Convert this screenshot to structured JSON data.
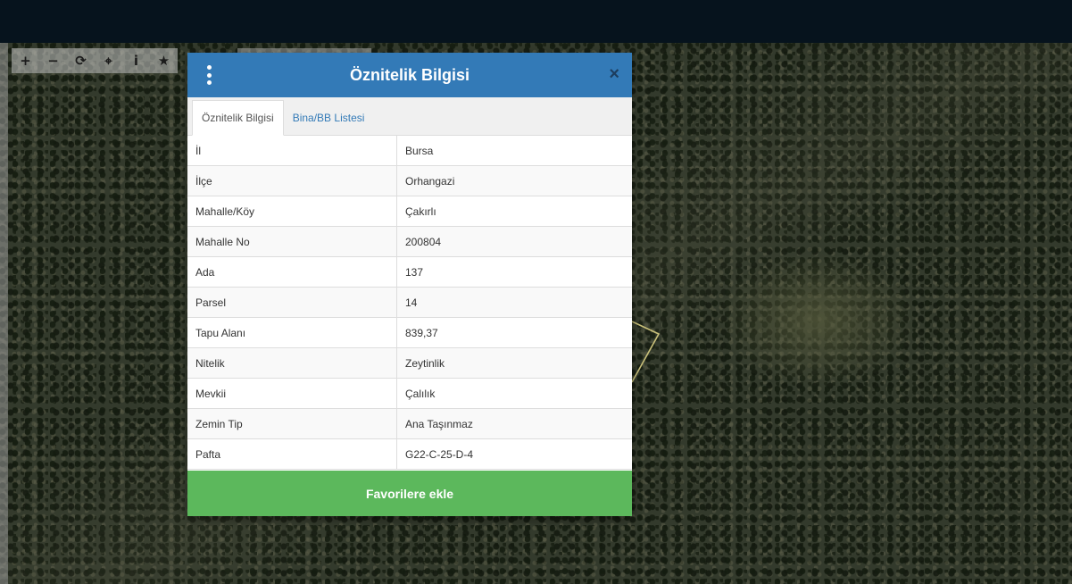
{
  "toolbar": {
    "tools": [
      {
        "icon": "zoom-in-icon",
        "glyph": "+"
      },
      {
        "icon": "zoom-out-icon",
        "glyph": "−"
      },
      {
        "icon": "refresh-icon",
        "glyph": "⟳"
      },
      {
        "icon": "crosshair-icon",
        "glyph": "⌖"
      },
      {
        "icon": "info-icon",
        "glyph": "i"
      },
      {
        "icon": "star-icon",
        "glyph": "★"
      }
    ]
  },
  "modal": {
    "title": "Öznitelik Bilgisi",
    "menu_icon": "vertical-dots-icon",
    "close_glyph": "×",
    "tabs": [
      {
        "label": "Öznitelik Bilgisi",
        "active": true
      },
      {
        "label": "Bina/BB Listesi",
        "active": false
      }
    ],
    "rows": [
      {
        "key": "İl",
        "value": "Bursa"
      },
      {
        "key": "İlçe",
        "value": "Orhangazi"
      },
      {
        "key": "Mahalle/Köy",
        "value": "Çakırlı"
      },
      {
        "key": "Mahalle No",
        "value": "200804"
      },
      {
        "key": "Ada",
        "value": "137"
      },
      {
        "key": "Parsel",
        "value": "14"
      },
      {
        "key": "Tapu Alanı",
        "value": "839,37"
      },
      {
        "key": "Nitelik",
        "value": "Zeytinlik"
      },
      {
        "key": "Mevkii",
        "value": "Çalılık"
      },
      {
        "key": "Zemin Tip",
        "value": "Ana Taşınmaz"
      },
      {
        "key": "Pafta",
        "value": "G22-C-25-D-4"
      }
    ],
    "favorite_label": "Favorilere ekle"
  },
  "colors": {
    "header": "#337ab7",
    "favorite_button": "#5cb85c",
    "topbar": "#06131d"
  }
}
